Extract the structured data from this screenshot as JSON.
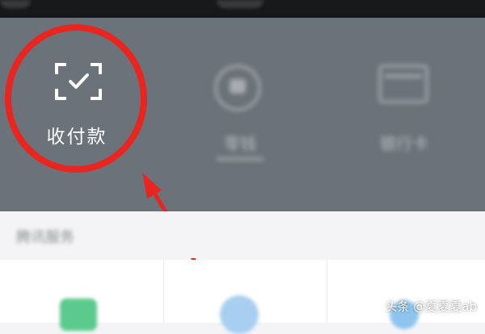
{
  "wallet": {
    "pay_receive_label": "收付款",
    "change_label": "零钱",
    "bank_card_label": "银行卡"
  },
  "section": {
    "title": "腾讯服务"
  },
  "watermark": "头条 @夏夏夏ab",
  "colors": {
    "panel": "#6b7279",
    "annotation_red": "#e8251f",
    "top_bar": "#17181a"
  }
}
